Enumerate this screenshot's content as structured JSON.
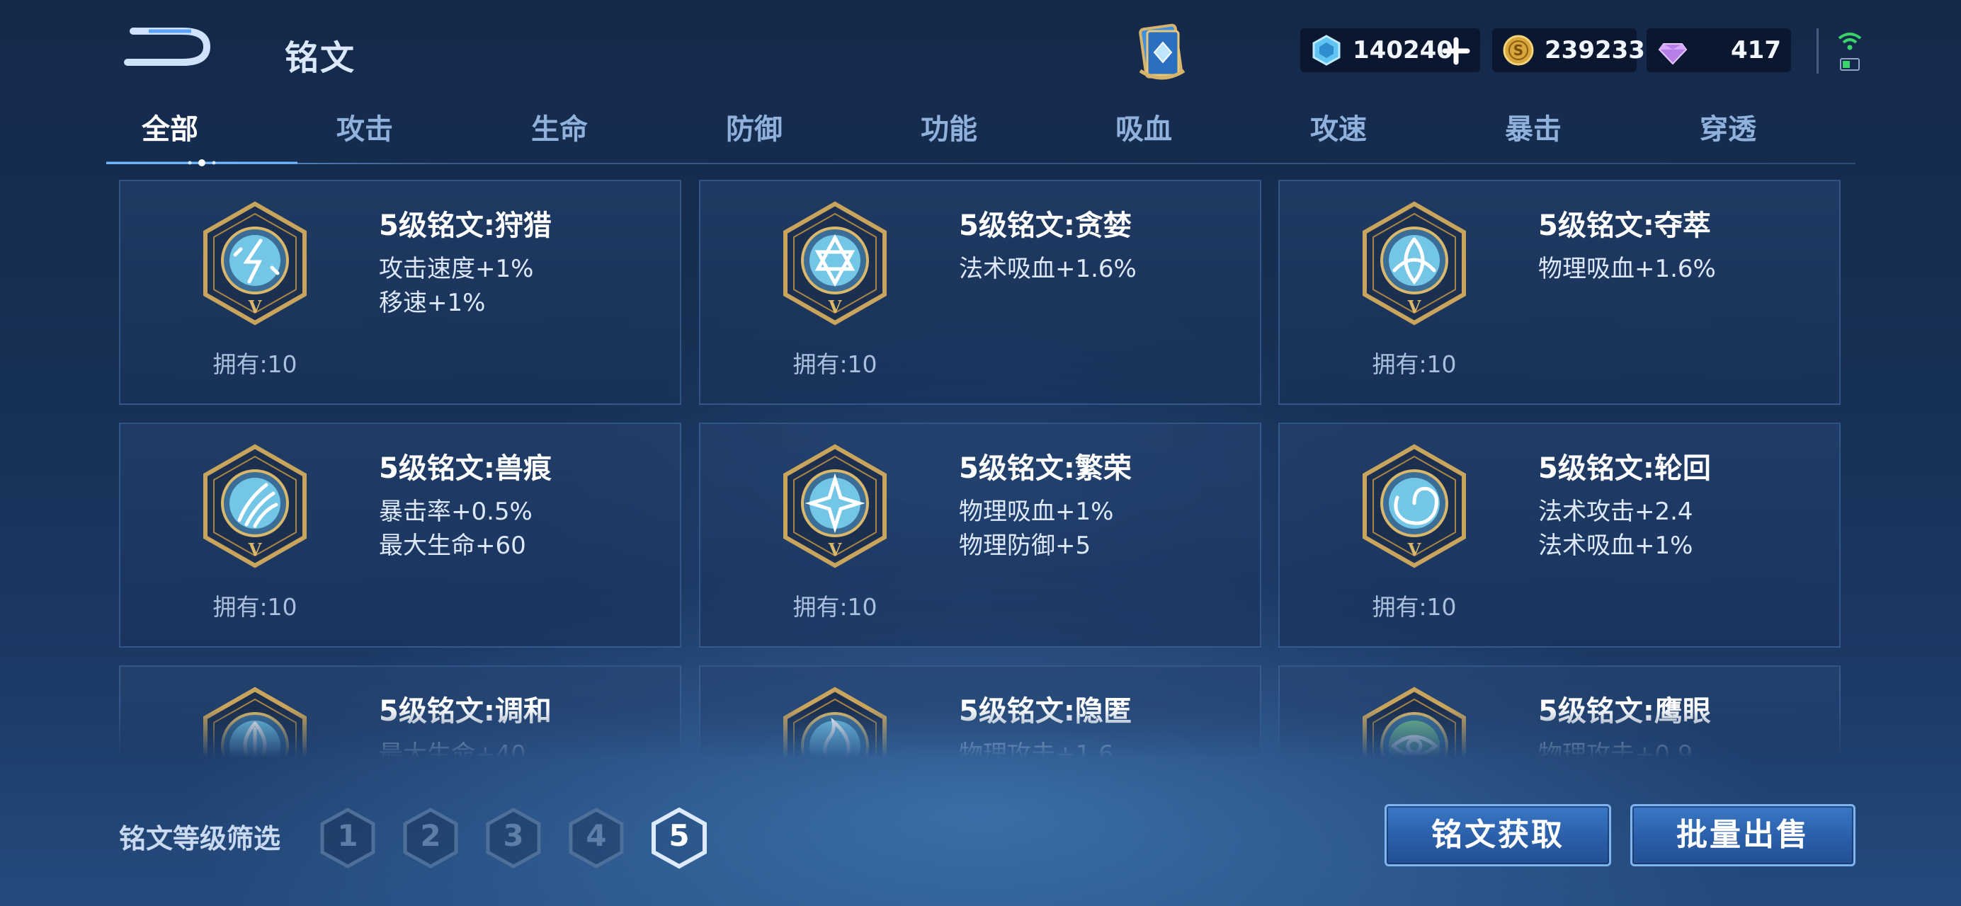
{
  "header": {
    "title": "铭文",
    "currencies": [
      {
        "icon": "ticket-crystal-icon",
        "value": "140240"
      },
      {
        "icon": "gold-coin-icon",
        "value": "239233"
      },
      {
        "icon": "diamond-gem-icon",
        "value": "417"
      }
    ]
  },
  "tabs": [
    {
      "label": "全部",
      "active": true
    },
    {
      "label": "攻击"
    },
    {
      "label": "生命"
    },
    {
      "label": "防御"
    },
    {
      "label": "功能"
    },
    {
      "label": "吸血"
    },
    {
      "label": "攻速"
    },
    {
      "label": "暴击"
    },
    {
      "label": "穿透"
    }
  ],
  "inscriptions": [
    {
      "name": "5级铭文:狩猎",
      "attrs": [
        "攻击速度+1%",
        "移速+1%"
      ],
      "owned": "拥有:10",
      "icon": "lightning-emblem-icon"
    },
    {
      "name": "5级铭文:贪婪",
      "attrs": [
        "法术吸血+1.6%"
      ],
      "owned": "拥有:10",
      "icon": "hexagram-emblem-icon"
    },
    {
      "name": "5级铭文:夺萃",
      "attrs": [
        "物理吸血+1.6%"
      ],
      "owned": "拥有:10",
      "icon": "triquetra-emblem-icon"
    },
    {
      "name": "5级铭文:兽痕",
      "attrs": [
        "暴击率+0.5%",
        "最大生命+60"
      ],
      "owned": "拥有:10",
      "icon": "claw-emblem-icon"
    },
    {
      "name": "5级铭文:繁荣",
      "attrs": [
        "物理吸血+1%",
        "物理防御+5"
      ],
      "owned": "拥有:10",
      "icon": "star-emblem-icon"
    },
    {
      "name": "5级铭文:轮回",
      "attrs": [
        "法术攻击+2.4",
        "法术吸血+1%"
      ],
      "owned": "拥有:10",
      "icon": "swirl-emblem-icon"
    },
    {
      "name": "5级铭文:调和",
      "attrs": [
        "最大生命+40"
      ],
      "owned": "",
      "icon": "leaf-emblem-icon"
    },
    {
      "name": "5级铭文:隐匿",
      "attrs": [
        "物理攻击+1.6"
      ],
      "owned": "",
      "icon": "flame-emblem-icon"
    },
    {
      "name": "5级铭文:鹰眼",
      "attrs": [
        "物理攻击+0.9"
      ],
      "owned": "",
      "icon": "eye-emblem-icon"
    }
  ],
  "filter": {
    "label": "铭文等级筛选",
    "levels": [
      "1",
      "2",
      "3",
      "4",
      "5"
    ],
    "selected": "5"
  },
  "actions": {
    "acquire_label": "铭文获取",
    "bulk_sell_label": "批量出售"
  },
  "colors": {
    "accent": "#7fb4ee",
    "gold_frame": "#c9a45c",
    "emblem_cyan": "#7fd6f5",
    "emblem_green": "#7cc98a"
  }
}
